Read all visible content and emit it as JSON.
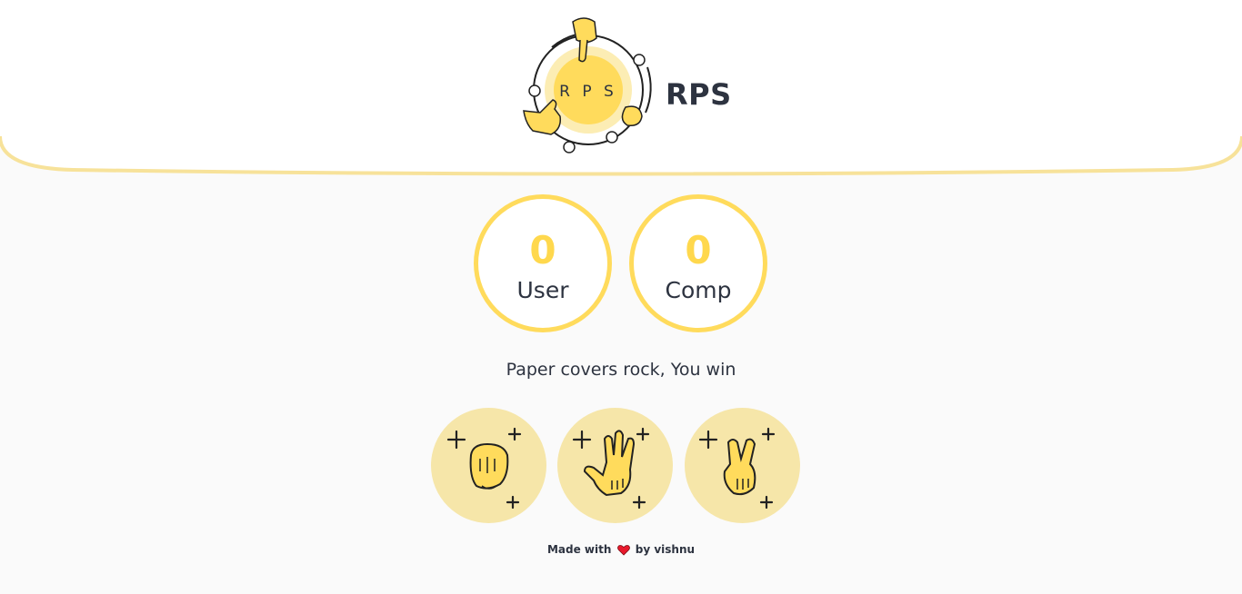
{
  "header": {
    "title": "RPS",
    "logo_text": "R P S"
  },
  "scores": {
    "user": {
      "value": "0",
      "label": "User"
    },
    "comp": {
      "value": "0",
      "label": "Comp"
    }
  },
  "result_message": "Paper covers rock, You win",
  "choices": [
    {
      "name": "rock",
      "icon": "rock-hand-icon"
    },
    {
      "name": "paper",
      "icon": "paper-hand-icon"
    },
    {
      "name": "scissors",
      "icon": "scissors-hand-icon"
    }
  ],
  "footer": {
    "made_with": "Made with",
    "by": "by vishnu"
  },
  "colors": {
    "accent": "#ffdb5c",
    "choice_bg": "#f6e6a9",
    "text": "#2d3340",
    "background": "#fafafa"
  }
}
